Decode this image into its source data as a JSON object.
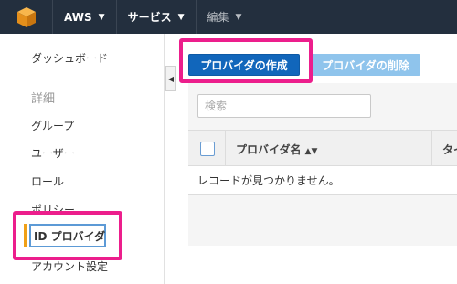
{
  "topbar": {
    "logo_icon": "aws-cube-icon",
    "account_label": "AWS",
    "services_label": "サービス",
    "edit_label": "編集"
  },
  "sidebar": {
    "dashboard_label": "ダッシュボード",
    "details_heading": "詳細",
    "groups_label": "グループ",
    "users_label": "ユーザー",
    "roles_label": "ロール",
    "policies_label": "ポリシー",
    "id_providers_label": "ID プロバイダ",
    "account_settings_label": "アカウント設定"
  },
  "toolbar": {
    "create_provider_label": "プロバイダの作成",
    "delete_provider_label": "プロバイダの削除"
  },
  "search": {
    "placeholder": "検索"
  },
  "table": {
    "columns": [
      "プロバイダ名",
      "タイ"
    ],
    "empty_message": "レコードが見つかりません。"
  },
  "colors": {
    "topbar_bg": "#232f3e",
    "primary_button": "#1166bb",
    "disabled_button": "#8fc4ec",
    "highlight_box": "#ec1e8c",
    "active_accent": "#f0a016"
  }
}
